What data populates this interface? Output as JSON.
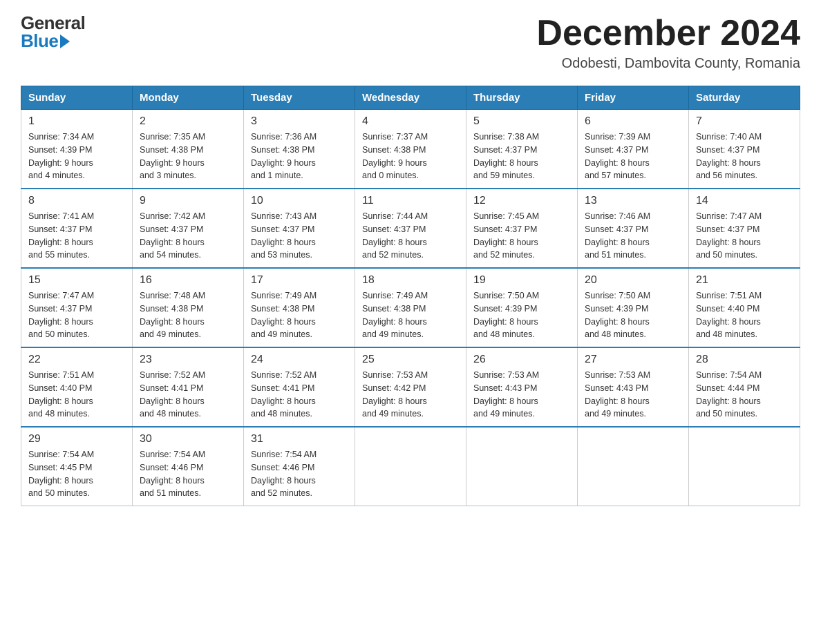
{
  "header": {
    "logo_general": "General",
    "logo_blue": "Blue",
    "month_title": "December 2024",
    "location": "Odobesti, Dambovita County, Romania"
  },
  "days_of_week": [
    "Sunday",
    "Monday",
    "Tuesday",
    "Wednesday",
    "Thursday",
    "Friday",
    "Saturday"
  ],
  "weeks": [
    [
      {
        "day": "1",
        "sunrise": "7:34 AM",
        "sunset": "4:39 PM",
        "daylight": "9 hours and 4 minutes."
      },
      {
        "day": "2",
        "sunrise": "7:35 AM",
        "sunset": "4:38 PM",
        "daylight": "9 hours and 3 minutes."
      },
      {
        "day": "3",
        "sunrise": "7:36 AM",
        "sunset": "4:38 PM",
        "daylight": "9 hours and 1 minute."
      },
      {
        "day": "4",
        "sunrise": "7:37 AM",
        "sunset": "4:38 PM",
        "daylight": "9 hours and 0 minutes."
      },
      {
        "day": "5",
        "sunrise": "7:38 AM",
        "sunset": "4:37 PM",
        "daylight": "8 hours and 59 minutes."
      },
      {
        "day": "6",
        "sunrise": "7:39 AM",
        "sunset": "4:37 PM",
        "daylight": "8 hours and 57 minutes."
      },
      {
        "day": "7",
        "sunrise": "7:40 AM",
        "sunset": "4:37 PM",
        "daylight": "8 hours and 56 minutes."
      }
    ],
    [
      {
        "day": "8",
        "sunrise": "7:41 AM",
        "sunset": "4:37 PM",
        "daylight": "8 hours and 55 minutes."
      },
      {
        "day": "9",
        "sunrise": "7:42 AM",
        "sunset": "4:37 PM",
        "daylight": "8 hours and 54 minutes."
      },
      {
        "day": "10",
        "sunrise": "7:43 AM",
        "sunset": "4:37 PM",
        "daylight": "8 hours and 53 minutes."
      },
      {
        "day": "11",
        "sunrise": "7:44 AM",
        "sunset": "4:37 PM",
        "daylight": "8 hours and 52 minutes."
      },
      {
        "day": "12",
        "sunrise": "7:45 AM",
        "sunset": "4:37 PM",
        "daylight": "8 hours and 52 minutes."
      },
      {
        "day": "13",
        "sunrise": "7:46 AM",
        "sunset": "4:37 PM",
        "daylight": "8 hours and 51 minutes."
      },
      {
        "day": "14",
        "sunrise": "7:47 AM",
        "sunset": "4:37 PM",
        "daylight": "8 hours and 50 minutes."
      }
    ],
    [
      {
        "day": "15",
        "sunrise": "7:47 AM",
        "sunset": "4:37 PM",
        "daylight": "8 hours and 50 minutes."
      },
      {
        "day": "16",
        "sunrise": "7:48 AM",
        "sunset": "4:38 PM",
        "daylight": "8 hours and 49 minutes."
      },
      {
        "day": "17",
        "sunrise": "7:49 AM",
        "sunset": "4:38 PM",
        "daylight": "8 hours and 49 minutes."
      },
      {
        "day": "18",
        "sunrise": "7:49 AM",
        "sunset": "4:38 PM",
        "daylight": "8 hours and 49 minutes."
      },
      {
        "day": "19",
        "sunrise": "7:50 AM",
        "sunset": "4:39 PM",
        "daylight": "8 hours and 48 minutes."
      },
      {
        "day": "20",
        "sunrise": "7:50 AM",
        "sunset": "4:39 PM",
        "daylight": "8 hours and 48 minutes."
      },
      {
        "day": "21",
        "sunrise": "7:51 AM",
        "sunset": "4:40 PM",
        "daylight": "8 hours and 48 minutes."
      }
    ],
    [
      {
        "day": "22",
        "sunrise": "7:51 AM",
        "sunset": "4:40 PM",
        "daylight": "8 hours and 48 minutes."
      },
      {
        "day": "23",
        "sunrise": "7:52 AM",
        "sunset": "4:41 PM",
        "daylight": "8 hours and 48 minutes."
      },
      {
        "day": "24",
        "sunrise": "7:52 AM",
        "sunset": "4:41 PM",
        "daylight": "8 hours and 48 minutes."
      },
      {
        "day": "25",
        "sunrise": "7:53 AM",
        "sunset": "4:42 PM",
        "daylight": "8 hours and 49 minutes."
      },
      {
        "day": "26",
        "sunrise": "7:53 AM",
        "sunset": "4:43 PM",
        "daylight": "8 hours and 49 minutes."
      },
      {
        "day": "27",
        "sunrise": "7:53 AM",
        "sunset": "4:43 PM",
        "daylight": "8 hours and 49 minutes."
      },
      {
        "day": "28",
        "sunrise": "7:54 AM",
        "sunset": "4:44 PM",
        "daylight": "8 hours and 50 minutes."
      }
    ],
    [
      {
        "day": "29",
        "sunrise": "7:54 AM",
        "sunset": "4:45 PM",
        "daylight": "8 hours and 50 minutes."
      },
      {
        "day": "30",
        "sunrise": "7:54 AM",
        "sunset": "4:46 PM",
        "daylight": "8 hours and 51 minutes."
      },
      {
        "day": "31",
        "sunrise": "7:54 AM",
        "sunset": "4:46 PM",
        "daylight": "8 hours and 52 minutes."
      },
      null,
      null,
      null,
      null
    ]
  ],
  "labels": {
    "sunrise": "Sunrise:",
    "sunset": "Sunset:",
    "daylight": "Daylight:"
  }
}
